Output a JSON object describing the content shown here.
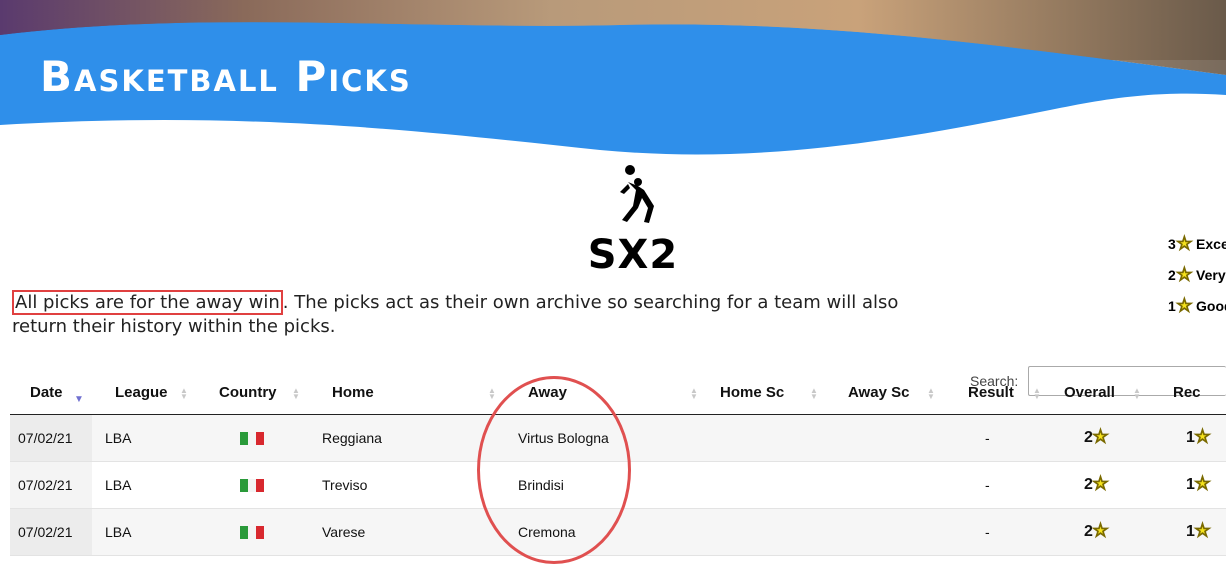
{
  "banner": {
    "title": "Basketball Picks"
  },
  "logo": {
    "text": "SX2",
    "icon": "basketball-player-icon"
  },
  "legend": [
    {
      "num": "3",
      "label": "Excelle"
    },
    {
      "num": "2",
      "label": "Very Go"
    },
    {
      "num": "1",
      "label": "Good"
    }
  ],
  "intro": {
    "highlight": "All picks are for the away win",
    "rest": ". The picks act as their own archive so searching for a team will also return their history within the picks."
  },
  "search": {
    "label": "Search:",
    "value": ""
  },
  "table": {
    "headers": [
      "Date",
      "League",
      "Country",
      "Home",
      "Away",
      "Home Sc",
      "Away Sc",
      "Result",
      "Overall",
      "Rec"
    ],
    "rows": [
      {
        "date": "07/02/21",
        "league": "LBA",
        "country": "Italy",
        "home": "Reggiana",
        "away": "Virtus Bologna",
        "home_sc": "",
        "away_sc": "",
        "result": "-",
        "overall": "2",
        "rec": "1"
      },
      {
        "date": "07/02/21",
        "league": "LBA",
        "country": "Italy",
        "home": "Treviso",
        "away": "Brindisi",
        "home_sc": "",
        "away_sc": "",
        "result": "-",
        "overall": "2",
        "rec": "1"
      },
      {
        "date": "07/02/21",
        "league": "LBA",
        "country": "Italy",
        "home": "Varese",
        "away": "Cremona",
        "home_sc": "",
        "away_sc": "",
        "result": "-",
        "overall": "2",
        "rec": "1"
      }
    ]
  },
  "colors": {
    "banner_blue": "#2f8fea",
    "highlight_red": "#e04040",
    "star_yellow": "#f6e31c"
  }
}
